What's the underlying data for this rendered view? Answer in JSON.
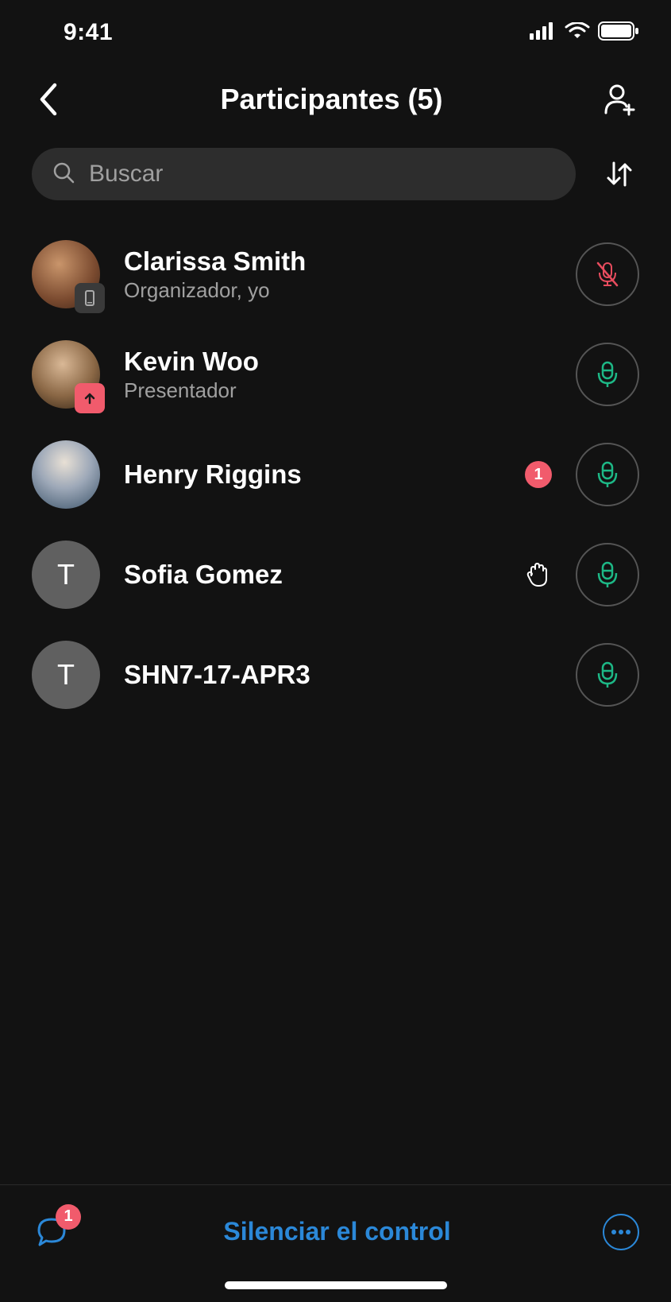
{
  "statusBar": {
    "time": "9:41"
  },
  "header": {
    "title": "Participantes (5)"
  },
  "search": {
    "placeholder": "Buscar"
  },
  "participants": [
    {
      "name": "Clarissa Smith",
      "role": "Organizador, yo",
      "initials": "",
      "avatarType": "photo-phone",
      "muted": true
    },
    {
      "name": "Kevin Woo",
      "role": "Presentador",
      "initials": "",
      "avatarType": "photo-screen",
      "muted": false
    },
    {
      "name": "Henry Riggins",
      "role": "",
      "initials": "",
      "avatarType": "photo",
      "muted": false,
      "badge": "1"
    },
    {
      "name": "Sofia Gomez",
      "role": "",
      "initials": "T",
      "avatarType": "initials",
      "muted": false,
      "handRaised": true
    },
    {
      "name": "SHN7-17-APR3",
      "role": "",
      "initials": "T",
      "avatarType": "initials",
      "muted": false
    }
  ],
  "bottomBar": {
    "chatBadge": "1",
    "muteAll": "Silenciar el control"
  }
}
